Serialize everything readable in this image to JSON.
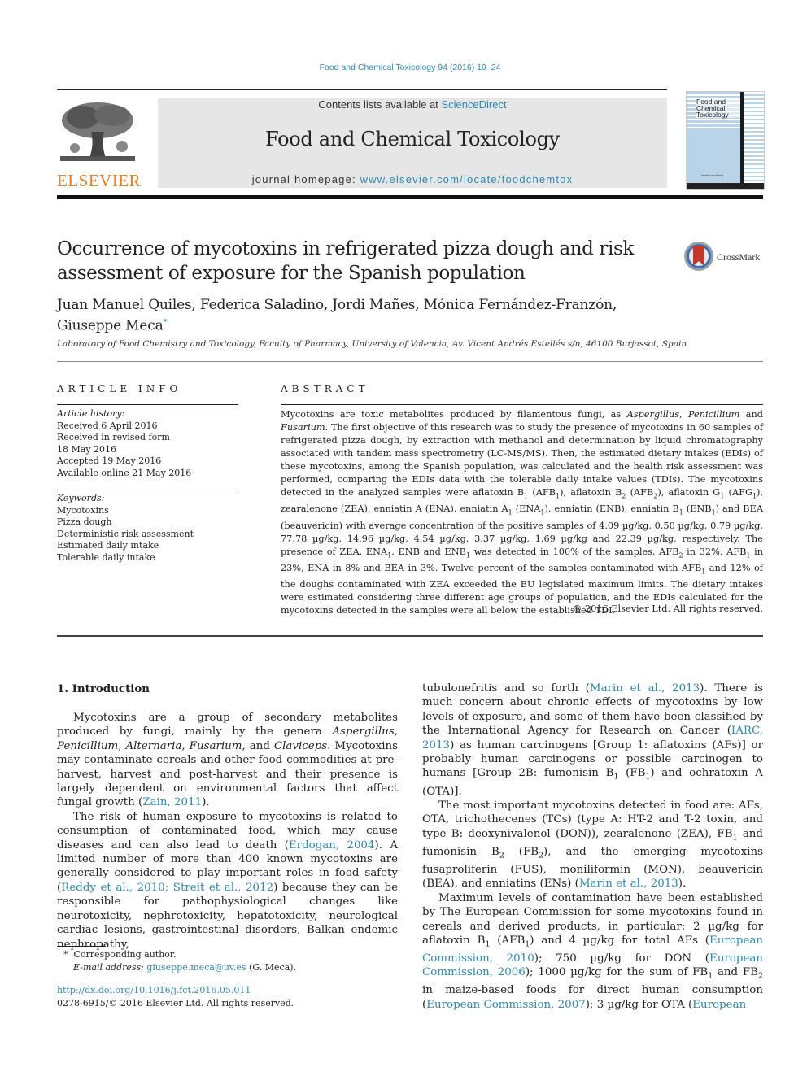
{
  "citation": "Food and Chemical Toxicology 94 (2016) 19–24",
  "header": {
    "publisher_logo_text": "ELSEVIER",
    "contents_prefix": "Contents lists available at ",
    "contents_link": "ScienceDirect",
    "journal_title": "Food and Chemical Toxicology",
    "homepage_prefix": "journal homepage: ",
    "homepage_link": "www.elsevier.com/locate/foodchemtox",
    "cover_title": "Food and Chemical Toxicology",
    "cover_foot": "InterKoord/vela"
  },
  "article": {
    "title": "Occurrence of mycotoxins in refrigerated pizza dough and risk assessment of exposure for the Spanish population",
    "crossmark_label": "CrossMark",
    "authors": "Juan Manuel Quiles, Federica Saladino, Jordi Mañes, Mónica Fernández-Franzón, Giuseppe Meca",
    "corresponding_mark": "*",
    "affiliation": "Laboratory of Food Chemistry and Toxicology, Faculty of Pharmacy, University of Valencia, Av. Vicent Andrés Estellés s/n, 46100 Burjassot, Spain"
  },
  "article_info": {
    "heading": "ARTICLE INFO",
    "history_label": "Article history:",
    "history": [
      "Received 6 April 2016",
      "Received in revised form",
      "18 May 2016",
      "Accepted 19 May 2016",
      "Available online 21 May 2016"
    ],
    "keywords_label": "Keywords:",
    "keywords": [
      "Mycotoxins",
      "Pizza dough",
      "Deterministic risk assessment",
      "Estimated daily intake",
      "Tolerable daily intake"
    ]
  },
  "abstract": {
    "heading": "ABSTRACT",
    "s1a": "Mycotoxins are toxic metabolites produced by filamentous fungi, as ",
    "g1": "Aspergillus",
    "s1b": ", ",
    "g2": "Penicillium",
    "s1c": " and ",
    "g3": "Fusarium",
    "s1d": ". The first objective of this research was to study the presence of mycotoxins in 60 samples of refrigerated pizza dough, by extraction with methanol and determination by liquid chromatography associated with tandem mass spectrometry (LC-MS/MS). Then, the estimated dietary intakes (EDIs) of these mycotoxins, among the Spanish population, was calculated and the health risk assessment was performed, comparing the EDIs data with the tolerable daily intake values (TDIs). The mycotoxins detected in the analyzed samples were aflatoxin B",
    "s2": " (AFB",
    "s3": "), aflatoxin B",
    "s4": " (AFB",
    "s5": "), aflatoxin G",
    "s6": " (AFG",
    "s7": "), zearalenone (ZEA), enniatin A (ENA), enniatin A",
    "s8": " (ENA",
    "s9": "), enniatin (ENB), enniatin B",
    "s10": " (ENB",
    "s11": ") and BEA (beauvericin) with average concentration of the positive samples of 4.09 µg/kg, 0.50 µg/kg, 0.79 µg/kg, 77.78 µg/kg, 14.96 µg/kg, 4.54 µg/kg, 3.37 µg/kg, 1.69 µg/kg and 22.39 µg/kg, respectively. The presence of ZEA, ENA",
    "s12": ", ENB and ENB",
    "s13": " was detected in 100% of the samples, AFB",
    "s14": " in 32%, AFB",
    "s15": " in 23%, ENA in 8% and BEA in 3%. Twelve percent of the samples contaminated with AFB",
    "s16": " and 12% of the doughs contaminated with ZEA exceeded the EU legislated maximum limits. The dietary intakes were estimated considering three different age groups of population, and the EDIs calculated for the mycotoxins detected in the samples were all below the established TDI.",
    "sub1": "1",
    "sub2": "2",
    "copyright": "© 2016 Elsevier Ltd. All rights reserved."
  },
  "introduction": {
    "heading": "1.  Introduction",
    "p1a": "Mycotoxins are a group of secondary metabolites produced by fungi, mainly by the genera ",
    "p1_aspergillus": "Aspergillus",
    "p1_sep1": ", ",
    "p1_penicillium": "Penicillium",
    "p1_sep2": ", ",
    "p1_alternaria": "Alternaria",
    "p1_sep3": ", ",
    "p1_fusarium": "Fusarium",
    "p1_sep4": ", and ",
    "p1_claviceps": "Claviceps",
    "p1b": ". Mycotoxins may contaminate cereals and other food commodities at pre-harvest, harvest and post-harvest and their presence is largely dependent on environmental factors that affect fungal growth (",
    "p1_ref": "Zain, 2011",
    "p1c": ").",
    "p2a": "The risk of human exposure to mycotoxins is related to consumption of contaminated food, which may cause diseases and can also lead to death (",
    "p2_ref1": "Erdogan, 2004",
    "p2b": "). A limited number of more than 400 known mycotoxins are generally considered to play important roles in food safety (",
    "p2_ref2": "Reddy et al., 2010; Streit et al., 2012",
    "p2c": ") because they can be responsible for pathophysiological changes like neurotoxicity, nephrotoxicity, hepatotoxicity, neurological cardiac lesions, gastrointestinal disorders, Balkan endemic nephropathy,",
    "r1a": "tubulonefritis and so forth (",
    "r1_ref1": "Marin et al., 2013",
    "r1b": "). There is much concern about chronic effects of mycotoxins by low levels of exposure, and some of them have been classified by the International Agency for Research on Cancer (",
    "r1_ref2": "IARC, 2013",
    "r1c": ") as human carcinogens [Group 1: aflatoxins (AFs)] or probably human carcinogens or possible carcinogen to humans [Group 2B: fumonisin B",
    "r1d": " (FB",
    "r1e": ") and ochratoxin A (OTA)].",
    "r2a": "The most important mycotoxins detected in food are: AFs, OTA, trichothecenes (TCs) (type A: HT-2 and T-2 toxin, and type B: deoxynivalenol (DON)), zearalenone (ZEA), FB",
    "r2b": " and fumonisin B",
    "r2c": " (FB",
    "r2d": "), and the emerging mycotoxins fusaproliferin (FUS), moniliformin (MON), beauvericin (BEA), and enniatins (ENs) (",
    "r2_ref": "Marin et al., 2013",
    "r2e": ").",
    "r3a": "Maximum levels of contamination have been established by The European Commission for some mycotoxins found in cereals and derived products, in particular: 2 µg/kg for aflatoxin B",
    "r3b": " (AFB",
    "r3c": ") and 4 µg/kg for total AFs (",
    "r3_ref1": "European Commission, 2010",
    "r3d": "); 750 µg/kg for DON (",
    "r3_ref2": "European Commission, 2006",
    "r3e": "); 1000 µg/kg for the sum of FB",
    "r3f": " and FB",
    "r3g": " in maize-based foods for direct human consumption (",
    "r3_ref3": "European Commission, 2007",
    "r3h": "); 3 µg/kg for OTA (",
    "r3_ref4": "European"
  },
  "footnote": {
    "mark": "*",
    "corresponding": "Corresponding author.",
    "email_label": "E-mail address: ",
    "email": "giuseppe.meca@uv.es",
    "email_suffix": " (G. Meca).",
    "doi": "http://dx.doi.org/10.1016/j.fct.2016.05.011",
    "issn_line": "0278-6915/© 2016 Elsevier Ltd. All rights reserved."
  }
}
